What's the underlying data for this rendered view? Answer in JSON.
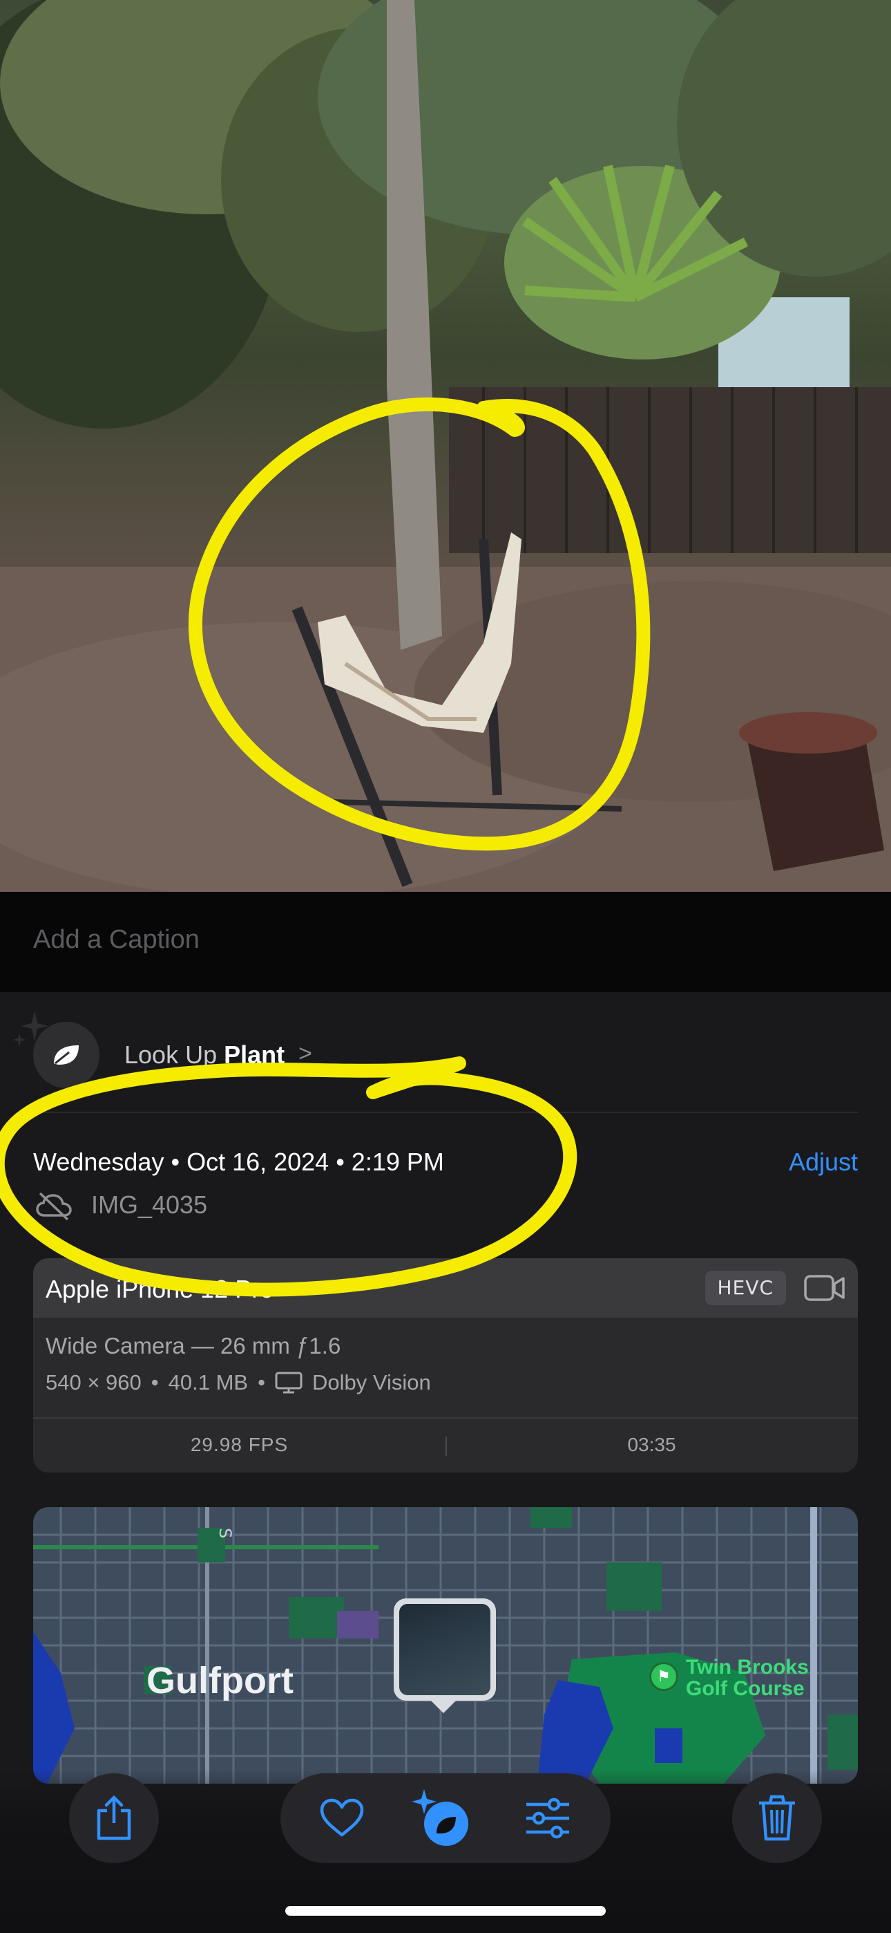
{
  "photo": {
    "subject": "hammock on stand under trees"
  },
  "caption": {
    "placeholder": "Add a Caption"
  },
  "lookup": {
    "prefix": "Look Up ",
    "subject": "Plant",
    "chevron": ">"
  },
  "info": {
    "date_line": "Wednesday • Oct 16, 2024 • 2:19 PM",
    "adjust_label": "Adjust",
    "filename": "IMG_4035"
  },
  "camera": {
    "device": "Apple iPhone 12 Pro",
    "format_badge": "HEVC",
    "lens": "Wide Camera — 26 mm ƒ1.6",
    "resolution": "540 × 960",
    "size": "40.1 MB",
    "hdr": "Dolby Vision",
    "fps": "29.98 FPS",
    "duration": "03:35"
  },
  "map": {
    "city_label": "Gulfport",
    "poi_label_line1": "Twin Brooks",
    "poi_label_line2": "Golf Course",
    "street_label": "S"
  },
  "toolbar": {
    "items": [
      "share-icon",
      "heart-icon",
      "visual-lookup-icon",
      "adjust-sliders-icon",
      "trash-icon"
    ]
  },
  "colors": {
    "accent": "#3291ff",
    "annotation": "#f5ec00",
    "panel": "#19191b",
    "golf": "#3ddc7a"
  }
}
